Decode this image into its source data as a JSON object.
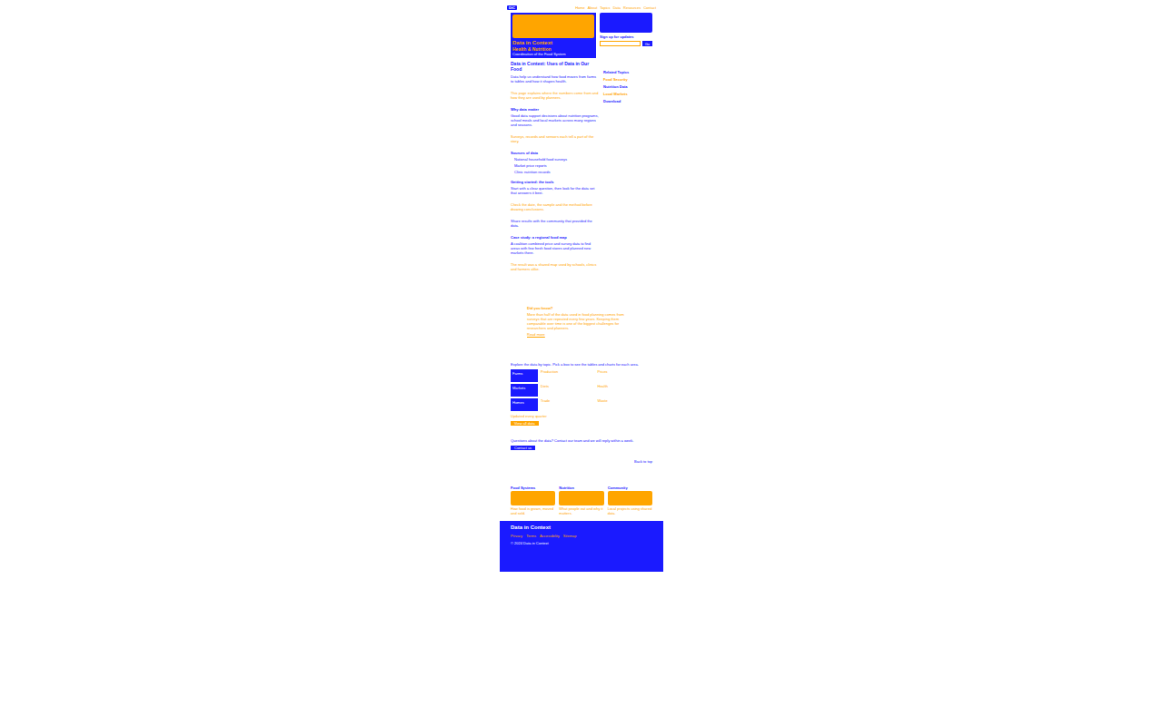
{
  "site": {
    "logo": "DiC",
    "title": "Data in Context",
    "subtitle": "Health & Nutrition",
    "strap": "Coordination of the Food System"
  },
  "nav": [
    "Home",
    "About",
    "Topics",
    "Data",
    "Resources",
    "Contact"
  ],
  "signup": {
    "label": "Sign up for updates",
    "button": "Go"
  },
  "article": {
    "title": "Data in Context: Uses of Data in Our Food",
    "blocks": [
      {
        "kind": "p",
        "text": "Data help us understand how food moves from farms to tables and how it shapes health.",
        "color": "#1a1aff"
      },
      {
        "kind": "p",
        "text": "This page explains where the numbers come from and how they are used by planners.",
        "color": "#ffa500"
      },
      {
        "kind": "h",
        "text": "Why data matter",
        "color": "#1a1aff"
      },
      {
        "kind": "p",
        "text": "Good data support decisions about nutrition programs, school meals and local markets across many regions and seasons.",
        "color": "#1a1aff"
      },
      {
        "kind": "p",
        "text": "Surveys, records and sensors each tell a part of the story.",
        "color": "#ffa500"
      },
      {
        "kind": "h",
        "text": "Sources of data",
        "color": "#1a1aff"
      },
      {
        "kind": "li",
        "text": "National household food surveys",
        "color": "#1a1aff"
      },
      {
        "kind": "li",
        "text": "Market price reports",
        "color": "#1a1aff"
      },
      {
        "kind": "li",
        "text": "Clinic nutrition records",
        "color": "#1a1aff"
      },
      {
        "kind": "h",
        "text": "Getting started: the tools",
        "color": "#1a1aff"
      },
      {
        "kind": "p",
        "text": "Start with a clear question, then look for the data set that answers it best.",
        "color": "#1a1aff"
      },
      {
        "kind": "p",
        "text": "Check the date, the sample and the method before drawing conclusions.",
        "color": "#ffa500"
      },
      {
        "kind": "p",
        "text": "Share results with the community that provided the data.",
        "color": "#1a1aff"
      },
      {
        "kind": "h",
        "text": "Case study: a regional food map",
        "color": "#1a1aff"
      },
      {
        "kind": "p",
        "text": "A coalition combined price and survey data to find areas with few fresh food stores and planned new markets there.",
        "color": "#1a1aff"
      },
      {
        "kind": "p",
        "text": "The result was a shared map used by schools, clinics and farmers alike.",
        "color": "#ffa500"
      }
    ]
  },
  "sidebar": [
    {
      "text": "Related Topics",
      "color": "#1a1aff"
    },
    {
      "text": "Food Security",
      "color": "#ffa500"
    },
    {
      "text": "Nutrition Data",
      "color": "#1a1aff"
    },
    {
      "text": "Local Markets",
      "color": "#ffa500"
    },
    {
      "text": "Download",
      "color": "#1a1aff"
    }
  ],
  "callout": {
    "title": "Did you know?",
    "text": "More than half of the data used in food planning comes from surveys that are repeated every few years. Keeping them comparable over time is one of the biggest challenges for researchers and planners.",
    "more": "Read more"
  },
  "explore": {
    "intro": "Explore the data by topic. Pick a box to see the tables and charts for each area.",
    "boxes": [
      "Farms",
      "Markets",
      "Homes"
    ],
    "links": [
      "Production",
      "Prices",
      "Diets",
      "Health",
      "Trade",
      "Waste"
    ],
    "note": "Updated every quarter",
    "button": "View all data"
  },
  "contact": {
    "text": "Questions about the data? Contact our team and we will reply within a week.",
    "button": "Contact us",
    "small": "Back to top"
  },
  "cards": [
    {
      "title": "Food Systems",
      "text": "How food is grown, moved and sold."
    },
    {
      "title": "Nutrition",
      "text": "What people eat and why it matters."
    },
    {
      "title": "Community",
      "text": "Local projects using shared data."
    }
  ],
  "footer": {
    "brand": "Data in Context",
    "links": [
      "Privacy",
      "Terms",
      "Accessibility",
      "Sitemap"
    ],
    "copyright": "© 2024 Data in Context"
  }
}
